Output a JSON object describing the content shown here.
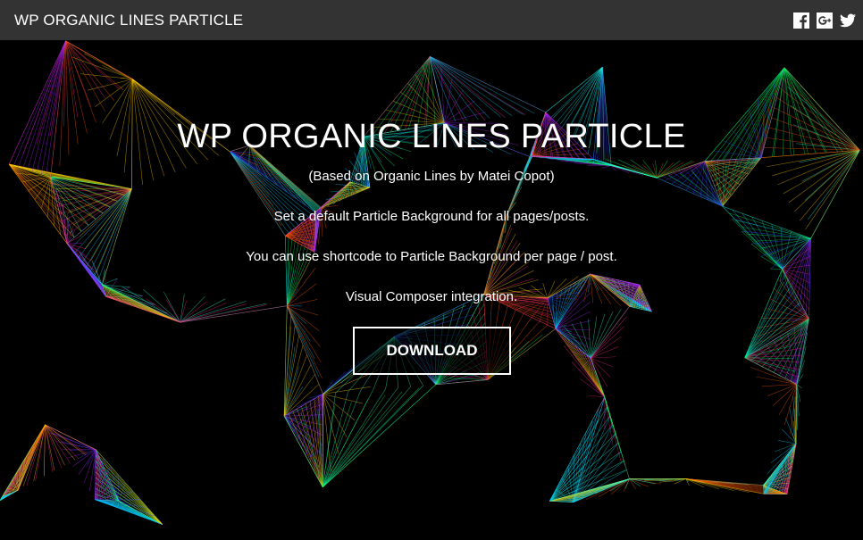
{
  "header": {
    "brand": "WP ORGANIC LINES PARTICLE",
    "social": [
      {
        "name": "facebook-icon"
      },
      {
        "name": "google-plus-icon"
      },
      {
        "name": "twitter-icon"
      }
    ]
  },
  "hero": {
    "title": "WP ORGANIC LINES PARTICLE",
    "subtitle": "(Based on Organic Lines by Matei Copot)",
    "lines": [
      "Set a default Particle Background for all pages/posts.",
      "You can use shortcode to Particle Background per page / post.",
      "Visual Composer integration."
    ],
    "download_label": "DOWNLOAD"
  },
  "colors": {
    "header_bg": "#333333",
    "hero_bg": "#000000",
    "text": "#ffffff",
    "particle_palette": [
      "#00ff66",
      "#00ccff",
      "#3344ff",
      "#aa22ff",
      "#ff2288",
      "#ffcc00",
      "#ff5500",
      "#22ffcc"
    ]
  }
}
